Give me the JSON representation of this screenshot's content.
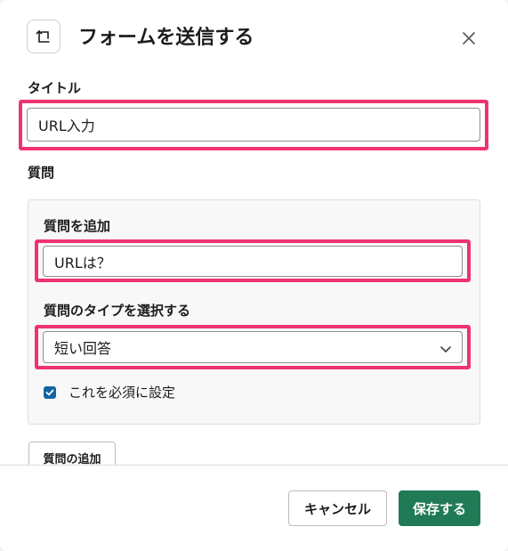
{
  "header": {
    "title": "フォームを送信する",
    "icon": "form-icon",
    "close_icon": "close-icon"
  },
  "form": {
    "title_label": "タイトル",
    "title_value": "URL入力",
    "questions_label": "質問",
    "question": {
      "add_label": "質問を追加",
      "question_value": "URLは？",
      "type_label": "質問のタイプを選択する",
      "type_selected": "短い回答",
      "required_label": "これを必須に設定",
      "required_checked": true
    },
    "add_question_button": "質問の追加"
  },
  "footer": {
    "cancel_label": "キャンセル",
    "save_label": "保存する"
  },
  "colors": {
    "highlight": "#f0326e",
    "primary": "#1f7a55",
    "checkbox": "#1264a3"
  }
}
